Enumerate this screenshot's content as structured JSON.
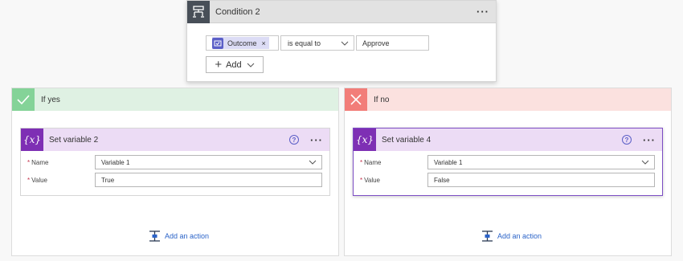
{
  "condition": {
    "title": "Condition 2",
    "more_label": "···",
    "operand_token": "Outcome",
    "token_remove": "×",
    "operator": "is equal to",
    "value": "Approve",
    "add_label": "Add"
  },
  "branches": {
    "yes": {
      "label": "If yes",
      "action": {
        "title": "Set variable 2",
        "more_label": "···",
        "help_label": "?",
        "name_label": "Name",
        "name_value": "Variable 1",
        "value_label": "Value",
        "value_value": "True"
      },
      "add_action_label": "Add an action"
    },
    "no": {
      "label": "If no",
      "action": {
        "title": "Set variable 4",
        "more_label": "···",
        "help_label": "?",
        "name_label": "Name",
        "name_value": "Variable 1",
        "value_label": "Value",
        "value_value": "False"
      },
      "add_action_label": "Add an action"
    }
  },
  "variable_icon_text": "{x}",
  "required_marker": "*",
  "icons": [
    "condition-icon",
    "approvals-icon",
    "plus-icon",
    "chevron-down-icon",
    "checkmark-icon",
    "close-icon",
    "variable-icon",
    "help-icon",
    "add-action-icon"
  ],
  "colors": {
    "yes_header": "#dff1e3",
    "yes_icon": "#84d398",
    "no_header": "#fbe1df",
    "no_icon": "#f27d79",
    "variable_header": "#ecdcf5",
    "variable_icon": "#7e2fb4",
    "link": "#2b63c8",
    "selected_border": "#7c4dc4"
  }
}
